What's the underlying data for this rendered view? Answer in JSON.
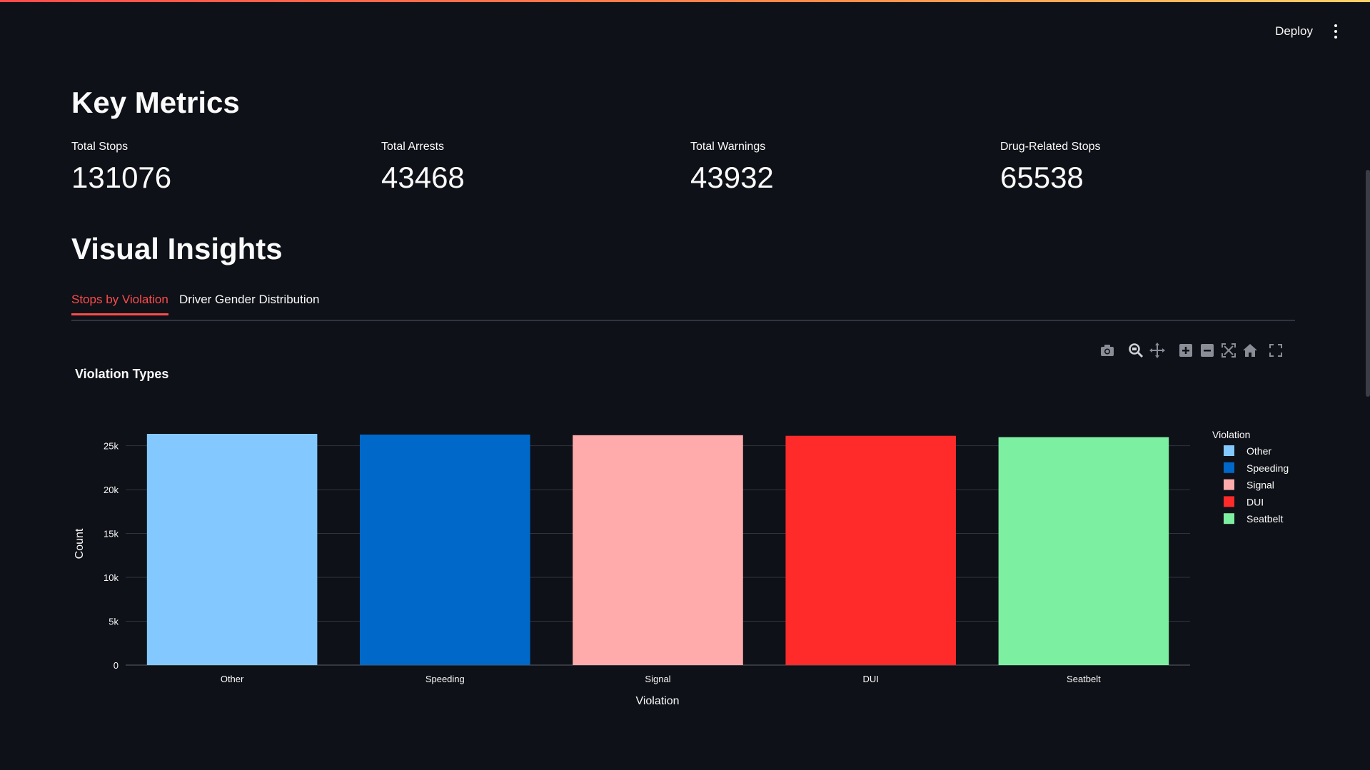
{
  "header": {
    "deploy_label": "Deploy",
    "menu_icon": "kebab-menu-icon"
  },
  "key_metrics": {
    "title": "Key Metrics",
    "items": [
      {
        "label": "Total Stops",
        "value": "131076"
      },
      {
        "label": "Total Arrests",
        "value": "43468"
      },
      {
        "label": "Total Warnings",
        "value": "43932"
      },
      {
        "label": "Drug-Related Stops",
        "value": "65538"
      }
    ]
  },
  "visual_insights": {
    "title": "Visual Insights",
    "tabs": [
      {
        "label": "Stops by Violation",
        "active": true
      },
      {
        "label": "Driver Gender Distribution",
        "active": false
      }
    ]
  },
  "modebar": {
    "icons": [
      "camera-icon",
      "zoom-icon",
      "pan-icon",
      "zoom-in-icon",
      "zoom-out-icon",
      "autoscale-icon",
      "reset-axes-icon",
      "fullscreen-icon"
    ]
  },
  "colors": {
    "accent": "#ff4b4b",
    "background": "#0e1117",
    "grid": "#31333f"
  },
  "chart_data": {
    "type": "bar",
    "title": "Violation Types",
    "xlabel": "Violation",
    "ylabel": "Count",
    "categories": [
      "Other",
      "Speeding",
      "Signal",
      "DUI",
      "Seatbelt"
    ],
    "values": [
      26350,
      26270,
      26200,
      26130,
      25980
    ],
    "colors": [
      "#83c9ff",
      "#0068c9",
      "#ffabab",
      "#ff2b2b",
      "#7defa1"
    ],
    "ylim": [
      0,
      27000
    ],
    "yticks": [
      0,
      5000,
      10000,
      15000,
      20000,
      25000
    ],
    "ytick_labels": [
      "0",
      "5k",
      "10k",
      "15k",
      "20k",
      "25k"
    ],
    "legend_title": "Violation",
    "legend_position": "top-right",
    "grid": true
  }
}
